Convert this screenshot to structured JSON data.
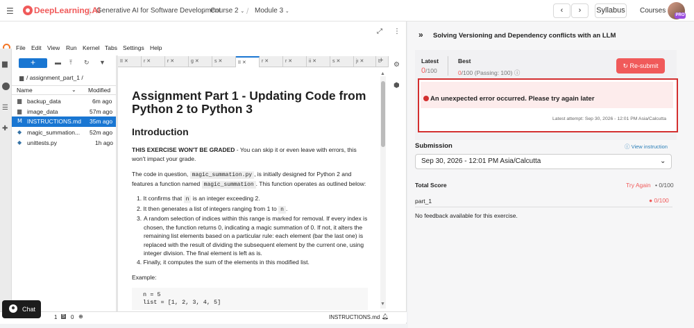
{
  "topbar": {
    "brand": "DeepLearning.AI",
    "course_title": "Generative AI for Software Development",
    "course_dropdown": "Course 2",
    "module_dropdown": "Module 3",
    "prev_glyph": "‹",
    "next_glyph": "›",
    "syllabus": "Syllabus",
    "courses": "Courses",
    "pro_badge": "PRO"
  },
  "lab": {
    "menu": [
      "File",
      "Edit",
      "View",
      "Run",
      "Kernel",
      "Tabs",
      "Settings",
      "Help"
    ],
    "filebrowser": {
      "path": "/ assignment_part_1 /",
      "col_name": "Name",
      "col_modified": "Modified",
      "files": [
        {
          "name": "backup_data",
          "modified": "6m ago",
          "icon": "folder-icon"
        },
        {
          "name": "image_data",
          "modified": "57m ago",
          "icon": "folder-icon"
        },
        {
          "name": "INSTRUCTIONS.md",
          "modified": "35m ago",
          "icon": "markdown-icon",
          "selected": true
        },
        {
          "name": "magic_summation...",
          "modified": "52m ago",
          "icon": "python-icon"
        },
        {
          "name": "unittests.py",
          "modified": "1h ago",
          "icon": "python-icon"
        }
      ]
    },
    "tabs": [
      "II",
      "r",
      "r",
      "g",
      "s",
      "II",
      "r",
      "r",
      "ii",
      "s",
      "jı",
      "L"
    ],
    "document": {
      "h1": "Assignment Part 1 - Updating Code from Python 2 to Python 3",
      "h2": "Introduction",
      "p1_bold": "THIS EXERCISE WON'T BE GRADED",
      "p1_rest": " - You can skip it or even leave with errors, this won't impact your grade.",
      "p2_a": "The code in question, ",
      "p2_code1": "magic_summation.py",
      "p2_b": ", is initially designed for Python 2 and features a function named ",
      "p2_code2": "magic_summation",
      "p2_c": ". This function operates as outlined below:",
      "li1_a": "It confirms that ",
      "li1_code": "n",
      "li1_b": " is an integer exceeding 2.",
      "li2_a": "It then generates a list of integers ranging from 1 to ",
      "li2_code": "n",
      "li2_b": ".",
      "li3": "A random selection of indices within this range is marked for removal. If every index is chosen, the function returns 0, indicating a magic summation of 0. If not, it alters the remaining list elements based on a particular rule: each element (bar the last one) is replaced with the result of dividing the subsequent element by the current one, using integer division. The final element is left as is.",
      "li4": "Finally, it computes the sum of the elements in this modified list.",
      "example": "Example:",
      "code_line1": "n = 5",
      "code_line2": "list = [1, 2, 3, 4, 5]"
    },
    "statusbar": {
      "left1": "1",
      "left2": "0",
      "filename": "INSTRUCTIONS.md",
      "count": "1"
    },
    "chat": "Chat"
  },
  "grader": {
    "title": "Solving Versioning and Dependency conflicts with an LLM",
    "latest_label": "Latest",
    "latest_score": "0",
    "latest_total": "/100",
    "best_label": "Best",
    "best_score": "0",
    "best_total": "/100 (Passing: 100)",
    "resubmit": "Re-submit",
    "error_message": "An unexpected error occurred. Please try again later",
    "latest_attempt": "Latest attempt: Sep 30, 2026 - 12:01 PM Asia/Calcutta",
    "submission_label": "Submission",
    "view_instruction": "View instruction",
    "submission_value": "Sep 30, 2026 - 12:01 PM Asia/Calcutta",
    "total_score_label": "Total Score",
    "try_again": "Try Again",
    "total_score": "0/100",
    "part_label": "part_1",
    "part_score": "0/100",
    "feedback": "No feedback available for this exercise."
  },
  "colors": {
    "brand": "#f05a5a",
    "selected_row": "#1976d2",
    "error_border": "#d32f2f"
  }
}
